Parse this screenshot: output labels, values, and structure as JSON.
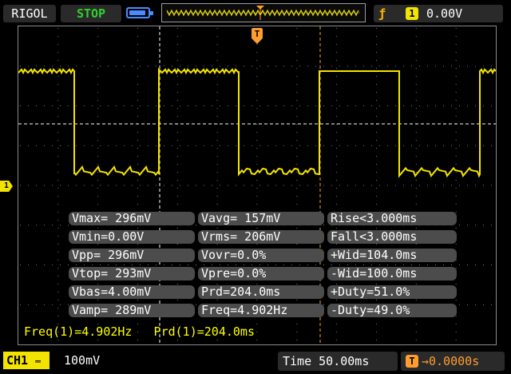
{
  "header": {
    "brand": "RIGOL",
    "run_state": "STOP",
    "trigger": {
      "edge_icon": "rising-edge-icon",
      "channel": "1",
      "level": "0.00V"
    }
  },
  "colors": {
    "trace": "#f2e300",
    "grid": "#8a8a8a",
    "cursor": "#ffffff",
    "trigger": "#ff9d2e",
    "run": "#2fd12f",
    "panel": "#4c4c4c",
    "readout": "#ffff00"
  },
  "screen": {
    "ch1_marker": "1",
    "trigger_marker": "T"
  },
  "measurements": {
    "rows": [
      [
        "Vmax= 296mV",
        "Vavg= 157mV",
        "Rise<3.000ms"
      ],
      [
        "Vmin=0.00V",
        "Vrms= 206mV",
        "Fall<3.000ms"
      ],
      [
        "Vpp= 296mV",
        "Vovr=0.0%",
        "+Wid=104.0ms"
      ],
      [
        "Vtop= 293mV",
        "Vpre=0.0%",
        "-Wid=100.0ms"
      ],
      [
        "Vbas=4.00mV",
        "Prd=204.0ms",
        "+Duty=51.0%"
      ],
      [
        "Vamp= 289mV",
        "Freq=4.902Hz",
        "-Duty=49.0%"
      ]
    ]
  },
  "cursor_readout": "Freq(1)=4.902Hz   Prd(1)=204.0ms",
  "footer": {
    "channel": "CH1",
    "scale": "100mV",
    "timebase": "Time 50.00ms",
    "trigger_offset_icon": "T",
    "trigger_offset": "0.0000s"
  }
}
